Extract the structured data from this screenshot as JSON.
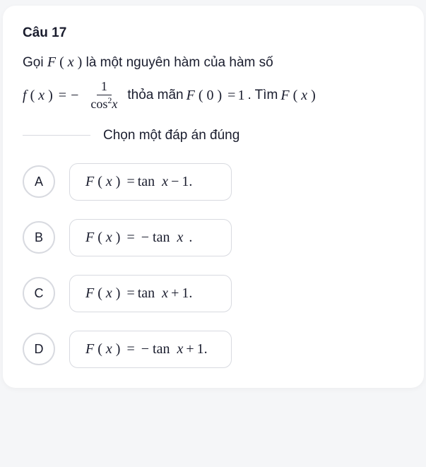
{
  "question": {
    "number": "Câu 17",
    "line1_prefix": "Gọi ",
    "F_label": "F",
    "x_label": "x",
    "line1_suffix": " là một nguyên hàm của hàm số",
    "f_label": "f",
    "eq": "=",
    "minus": "−",
    "frac_num": "1",
    "frac_den_cos": "cos",
    "frac_den_exp": "2",
    "satisfy": " thỏa mãn ",
    "zero": "0",
    "one": "1",
    "find": ". Tìm ",
    "period": ""
  },
  "instruction": "Chọn một đáp án đúng",
  "options": [
    {
      "letter": "A",
      "expr": {
        "sign": "",
        "trig": "tan",
        "tail_op": "−",
        "tail_num": "1."
      }
    },
    {
      "letter": "B",
      "expr": {
        "sign": "− ",
        "trig": "tan",
        "tail_op": "",
        "tail_num": "."
      }
    },
    {
      "letter": "C",
      "expr": {
        "sign": "",
        "trig": "tan",
        "tail_op": "+",
        "tail_num": "1."
      }
    },
    {
      "letter": "D",
      "expr": {
        "sign": "− ",
        "trig": "tan",
        "tail_op": "+",
        "tail_num": "1."
      }
    }
  ]
}
